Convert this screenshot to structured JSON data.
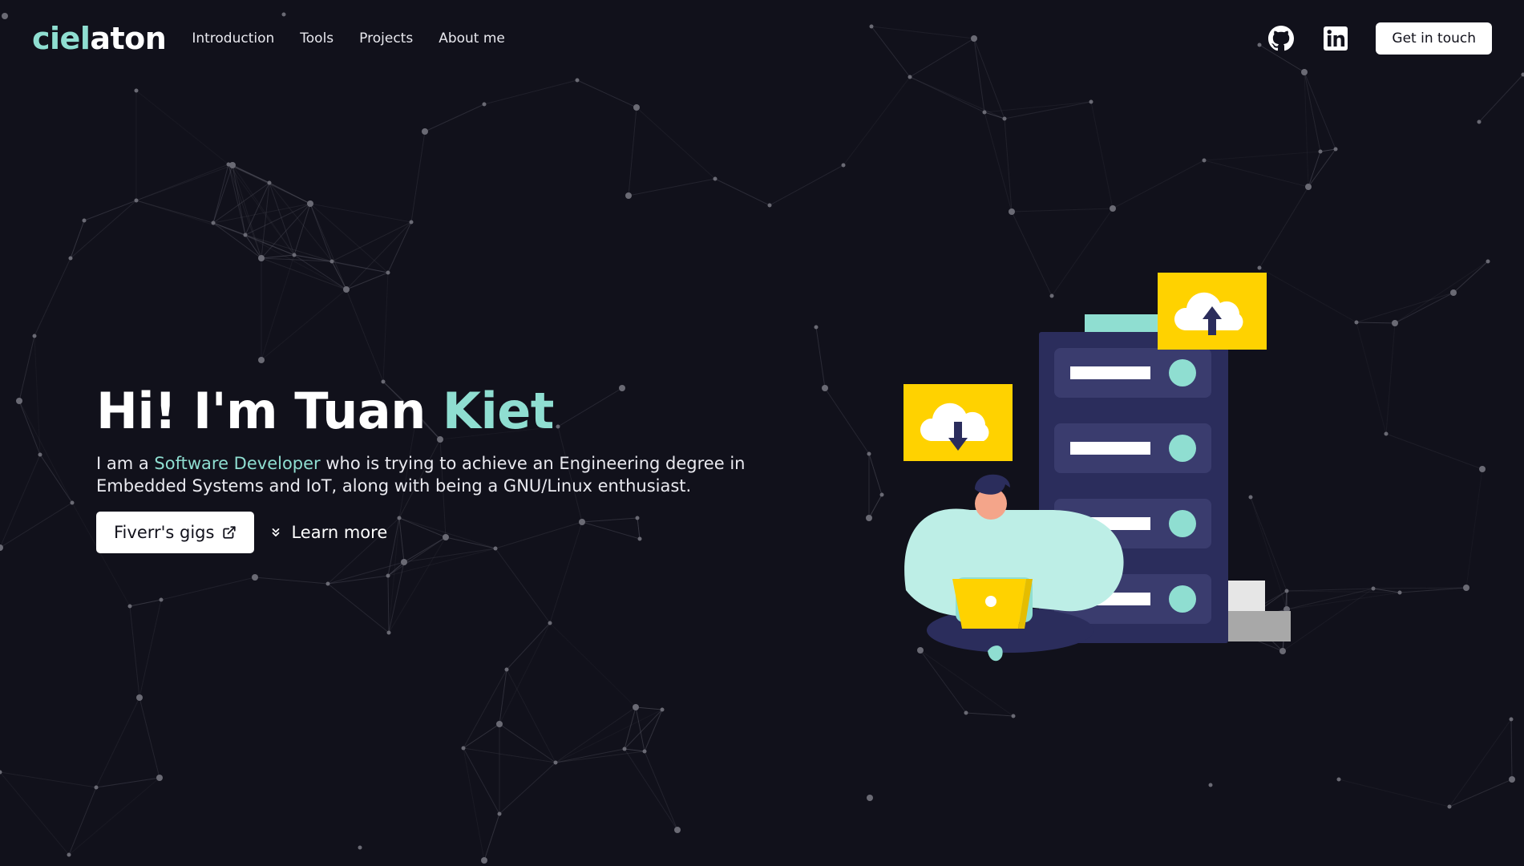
{
  "brand": {
    "part1": "ciel",
    "part2": "aton"
  },
  "nav": {
    "links": [
      "Introduction",
      "Tools",
      "Projects",
      "About me"
    ],
    "github_icon": "github-icon",
    "linkedin_icon": "linkedin-icon",
    "cta_label": "Get in touch"
  },
  "hero": {
    "title_prefix": "Hi! I'm Tuan ",
    "title_accent": "Kiet",
    "desc_prefix": "I am a ",
    "desc_accent": "Software Developer",
    "desc_suffix": " who is trying to achieve an Engineering degree in Embedded Systems and IoT, along with being a GNU/Linux enthusiast.",
    "primary_button": "Fiverr's gigs",
    "primary_icon": "external-link-icon",
    "secondary_button": "Learn more",
    "secondary_icon": "chevrons-down-icon"
  },
  "colors": {
    "background": "#11111b",
    "accent": "#8fded1",
    "server": "#2b2d5c",
    "cloud_box": "#ffd200"
  }
}
